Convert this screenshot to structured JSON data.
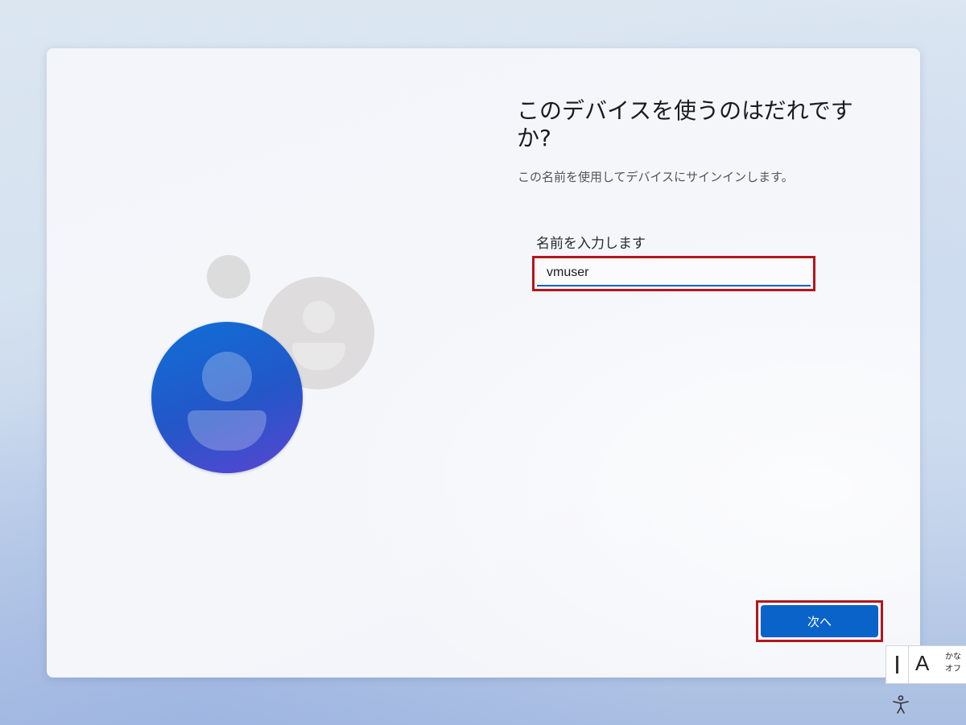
{
  "oobe": {
    "title": "このデバイスを使うのはだれですか?",
    "subtitle": "この名前を使用してデバイスにサインインします。",
    "name_field": {
      "label": "名前を入力します",
      "value": "vmuser"
    },
    "next_label": "次へ"
  },
  "ime": {
    "mode_char": "A",
    "kana_line1": "かな",
    "kana_line2": "オフ"
  },
  "icons": {
    "avatar": "user-avatar-icon",
    "accessibility": "accessibility-icon"
  },
  "colors": {
    "accent": "#0a63c9",
    "highlight_border": "#b4161c"
  }
}
